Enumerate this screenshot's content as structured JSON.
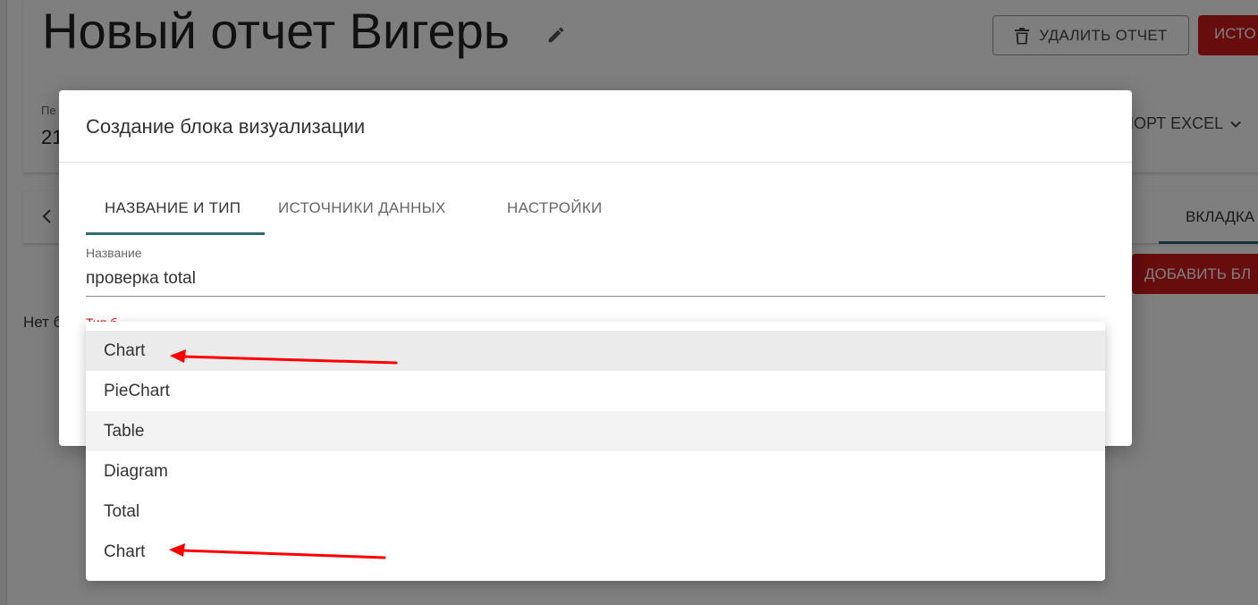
{
  "header": {
    "title": "Новый отчет Вигерь",
    "edit_icon": "pencil-icon",
    "delete_button": "УДАЛИТЬ ОТЧЕТ",
    "delete_icon": "trash-icon",
    "red_button": "ИСТО",
    "period_label": "Пе",
    "period_value": "21",
    "export_button": "ПОРТ EXCEL",
    "export_icon": "chevron-down-icon"
  },
  "tabs_bar": {
    "back_icon": "chevron-left-icon",
    "active_page_tab": "ВКЛАДКА"
  },
  "main": {
    "add_block_button": "ДОБАВИТЬ БЛ",
    "empty_text": "Нет б"
  },
  "modal": {
    "title": "Создание блока визуализации",
    "tabs": [
      {
        "label": "НАЗВАНИЕ И ТИП"
      },
      {
        "label": "ИСТОЧНИКИ ДАННЫХ"
      },
      {
        "label": "НАСТРОЙКИ"
      }
    ],
    "name_field": {
      "label": "Название",
      "value": "проверка total"
    },
    "type_field_label": "Тип б"
  },
  "dropdown": {
    "options": [
      {
        "label": "Chart"
      },
      {
        "label": "PieChart"
      },
      {
        "label": "Table"
      },
      {
        "label": "Diagram"
      },
      {
        "label": "Total"
      },
      {
        "label": "Chart"
      }
    ]
  },
  "annotations": {
    "arrow_color": "#ff0000"
  }
}
